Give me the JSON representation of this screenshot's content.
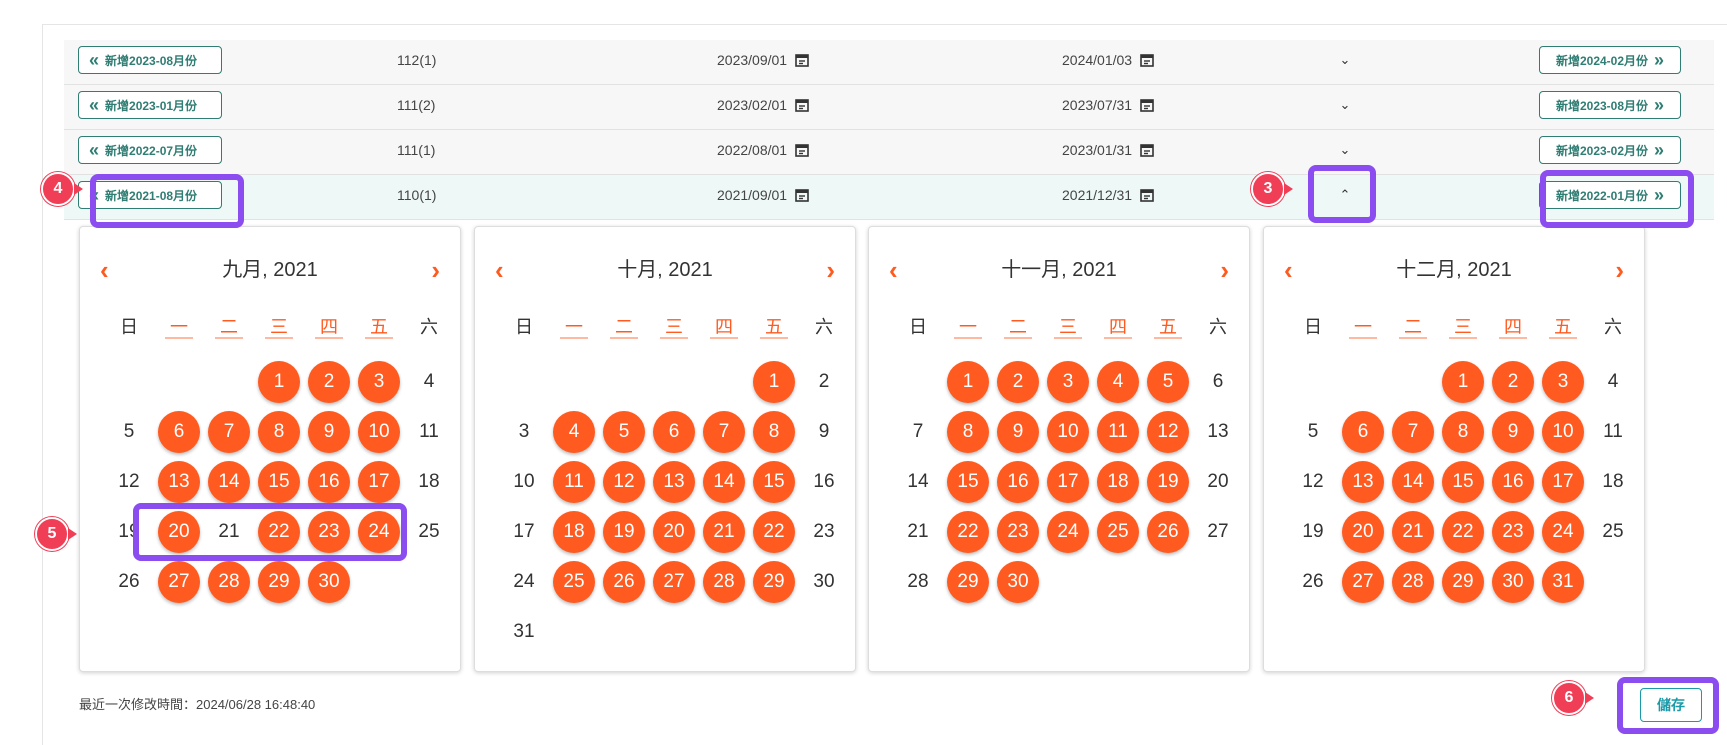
{
  "rows": [
    {
      "prev_label": "新增2023-08月份",
      "term": "112(1)",
      "start": "2023/09/01",
      "end": "2024/01/03",
      "toggle": "⌄",
      "next_label": "新增2024-02月份"
    },
    {
      "prev_label": "新增2023-01月份",
      "term": "111(2)",
      "start": "2023/02/01",
      "end": "2023/07/31",
      "toggle": "⌄",
      "next_label": "新增2023-08月份"
    },
    {
      "prev_label": "新增2022-07月份",
      "term": "111(1)",
      "start": "2022/08/01",
      "end": "2023/01/31",
      "toggle": "⌄",
      "next_label": "新增2023-02月份"
    },
    {
      "prev_label": "新增2021-08月份",
      "term": "110(1)",
      "start": "2021/09/01",
      "end": "2021/12/31",
      "toggle": "⌃",
      "next_label": "新增2022-01月份"
    }
  ],
  "weekdays": [
    "日",
    "一",
    "二",
    "三",
    "四",
    "五",
    "六"
  ],
  "calendars": [
    {
      "title": "九月, 2021",
      "first_weekday": 3,
      "days_in_month": 30,
      "selected": [
        1,
        2,
        3,
        6,
        7,
        8,
        9,
        10,
        13,
        14,
        15,
        16,
        17,
        20,
        22,
        23,
        24,
        27,
        28,
        29,
        30
      ]
    },
    {
      "title": "十月, 2021",
      "first_weekday": 5,
      "days_in_month": 31,
      "selected": [
        1,
        4,
        5,
        6,
        7,
        8,
        11,
        12,
        13,
        14,
        15,
        18,
        19,
        20,
        21,
        22,
        25,
        26,
        27,
        28,
        29
      ]
    },
    {
      "title": "十一月, 2021",
      "first_weekday": 1,
      "days_in_month": 30,
      "selected": [
        1,
        2,
        3,
        4,
        5,
        8,
        9,
        10,
        11,
        12,
        15,
        16,
        17,
        18,
        19,
        22,
        23,
        24,
        25,
        26,
        29,
        30
      ]
    },
    {
      "title": "十二月, 2021",
      "first_weekday": 3,
      "days_in_month": 31,
      "selected": [
        1,
        2,
        3,
        6,
        7,
        8,
        9,
        10,
        13,
        14,
        15,
        16,
        17,
        20,
        21,
        22,
        23,
        24,
        27,
        28,
        29,
        30,
        31
      ]
    }
  ],
  "nav": {
    "prev": "‹",
    "next": "›"
  },
  "footer": {
    "last_modified": "最近一次修改時間：2024/06/28 16:48:40",
    "save_label": "儲存"
  },
  "markers": [
    "3",
    "4",
    "5",
    "6"
  ],
  "colors": {
    "accent": "#ff5a1f",
    "teal": "#2f7d73",
    "highlight": "#8b4cf0",
    "marker": "#f03e57"
  }
}
